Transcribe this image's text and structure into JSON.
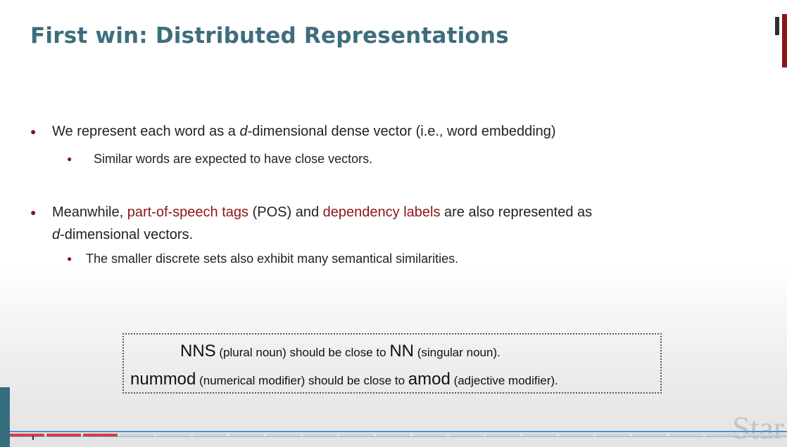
{
  "slide": {
    "title": "First win: Distributed Representations",
    "bullet1": {
      "pre": "We represent each word as a ",
      "var": "d",
      "post": "-dimensional dense vector (i.e., word embedding)",
      "sub": "Similar words are expected to have close vectors."
    },
    "bullet2": {
      "pre": "Meanwhile, ",
      "pos_term": "part-of-speech tags",
      "mid": " (POS) and ",
      "dep_term": "dependency labels",
      "post": " are also represented as",
      "line2_var": "d",
      "line2_post": "-dimensional vectors.",
      "sub": "The smaller discrete sets also exhibit many semantical similarities."
    },
    "example": {
      "line1": {
        "t1": "NNS",
        "t2": " (plural noun) should be close to ",
        "t3": "NN",
        "t4": " (singular noun)."
      },
      "line2": {
        "t1": "nummod",
        "t2": " (numerical modifier) should be close to ",
        "t3": "amod",
        "t4": " (adjective modifier)."
      }
    },
    "watermark": "Star"
  },
  "colors": {
    "title": "#3d6e7e",
    "accent": "#8c1515",
    "progress_played": "#d63c3c"
  },
  "player": {
    "progress": 0.15
  }
}
